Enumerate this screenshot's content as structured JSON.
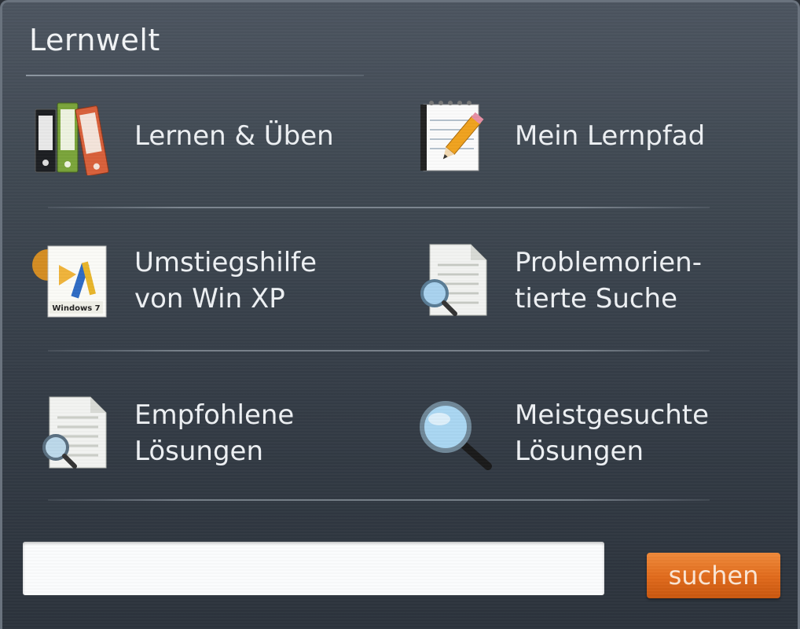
{
  "panel": {
    "title": "Lernwelt"
  },
  "items": [
    {
      "label": "Lernen & Üben",
      "icon": "binders-icon"
    },
    {
      "label": "Mein Lernpfad",
      "icon": "notepad-pencil-icon"
    },
    {
      "label": "Umstiegshilfe\nvon Win XP",
      "icon": "windows-upgrade-icon"
    },
    {
      "label": "Problemorien-\ntierte Suche",
      "icon": "document-search-icon"
    },
    {
      "label": "Empfohlene\nLösungen",
      "icon": "document-magnifier-icon"
    },
    {
      "label": "Meistgesuchte\nLösungen",
      "icon": "magnifying-glass-icon"
    }
  ],
  "search": {
    "placeholder": "",
    "value": "",
    "button_label": "suchen"
  },
  "colors": {
    "accent": "#e06a1b",
    "panel_bg": "#3f4852",
    "text": "#eef1f4"
  }
}
